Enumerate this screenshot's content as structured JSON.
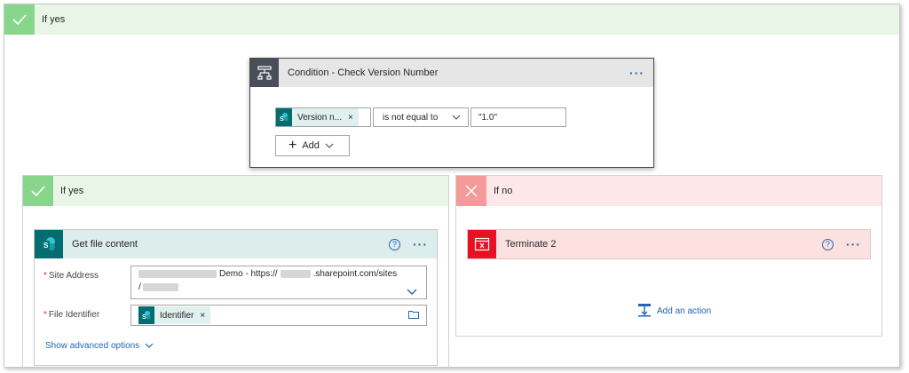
{
  "top_branch": {
    "label": "If yes"
  },
  "condition": {
    "title": "Condition - Check Version Number",
    "left_token": "Version n...",
    "operator": "is not equal to",
    "value": "\"1.0\"",
    "add_label": "Add"
  },
  "yes_branch": {
    "label": "If yes",
    "action": {
      "title": "Get file content",
      "site_address_label": "Site Address",
      "site_address_mid": "Demo - https://",
      "site_address_end": ".sharepoint.com/sites",
      "site_address_line2": "/",
      "file_identifier_label": "File Identifier",
      "file_identifier_token": "Identifier",
      "advanced_label": "Show advanced options"
    }
  },
  "no_branch": {
    "label": "If no",
    "action": {
      "title": "Terminate 2"
    },
    "add_action_label": "Add an action"
  },
  "colors": {
    "yes": "#88d68b",
    "no": "#f59a9a",
    "accent": "#2266b0",
    "sharepoint": "#036c70",
    "terminate": "#e81123"
  }
}
